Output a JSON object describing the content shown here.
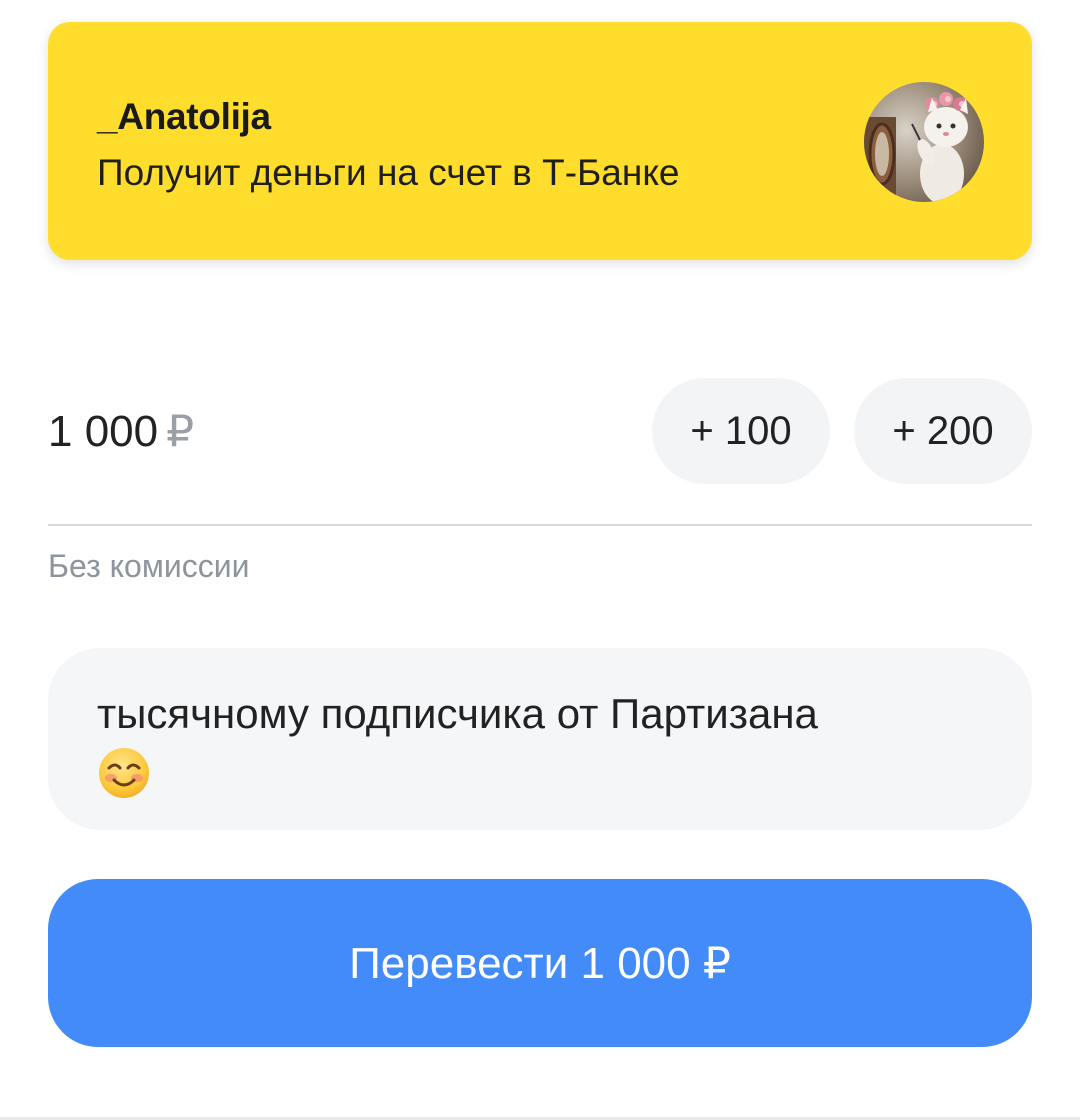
{
  "recipient": {
    "name": "_Anatolija",
    "subtitle": "Получит деньги на счет в Т-Банке",
    "card_color": "#ffdd2d"
  },
  "amount": {
    "value": "1 000",
    "currency": "₽"
  },
  "quick_add": {
    "chip_100": "+ 100",
    "chip_200": "+ 200"
  },
  "fee_note": "Без комиссии",
  "message": {
    "text": "тысячному подписчика от Партизана",
    "emoji_icon": "smiling-face-emoji-icon"
  },
  "transfer_button": {
    "label": "Перевести 1 000 ₽",
    "color": "#428bf9"
  }
}
